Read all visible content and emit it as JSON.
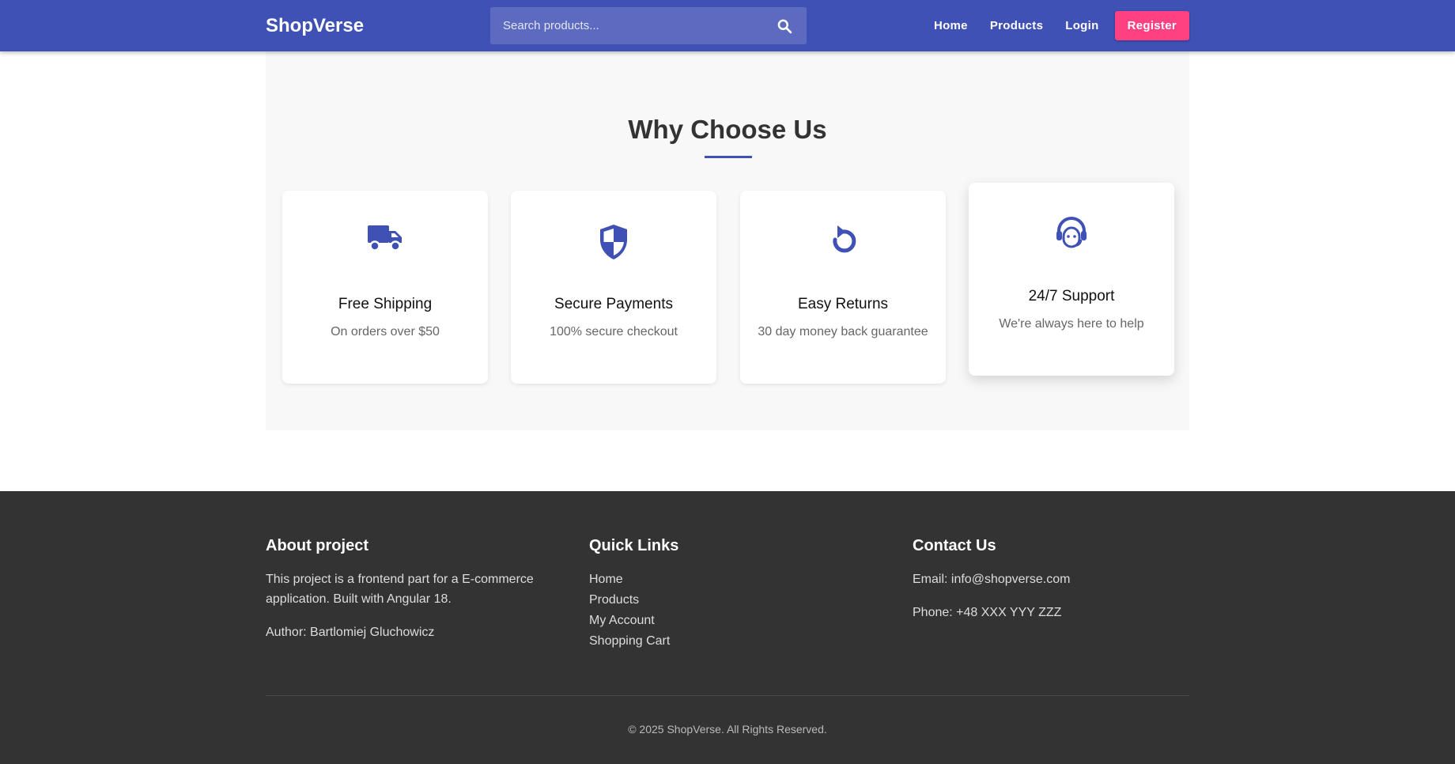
{
  "header": {
    "logo": "ShopVerse",
    "search_placeholder": "Search products...",
    "nav": {
      "home": "Home",
      "products": "Products",
      "login": "Login",
      "register": "Register"
    },
    "colors": {
      "bar": "#3f51b5",
      "accent": "#ff4081"
    }
  },
  "features": {
    "title": "Why Choose Us",
    "cards": [
      {
        "icon": "truck-icon",
        "title": "Free Shipping",
        "desc": "On orders over $50"
      },
      {
        "icon": "shield-icon",
        "title": "Secure Payments",
        "desc": "100% secure checkout"
      },
      {
        "icon": "undo-icon",
        "title": "Easy Returns",
        "desc": "30 day money back guarantee"
      },
      {
        "icon": "headset-icon",
        "title": "24/7 Support",
        "desc": "We're always here to help"
      }
    ]
  },
  "footer": {
    "about": {
      "heading": "About project",
      "text": "This project is a frontend part for a E-commerce application. Built with Angular 18.",
      "author": "Author: Bartlomiej Gluchowicz"
    },
    "quick_links": {
      "heading": "Quick Links",
      "items": [
        "Home",
        "Products",
        "My Account",
        "Shopping Cart"
      ]
    },
    "contact": {
      "heading": "Contact Us",
      "email": "Email: info@shopverse.com",
      "phone": "Phone: +48 XXX YYY ZZZ"
    },
    "copyright": "© 2025 ShopVerse. All Rights Reserved."
  }
}
